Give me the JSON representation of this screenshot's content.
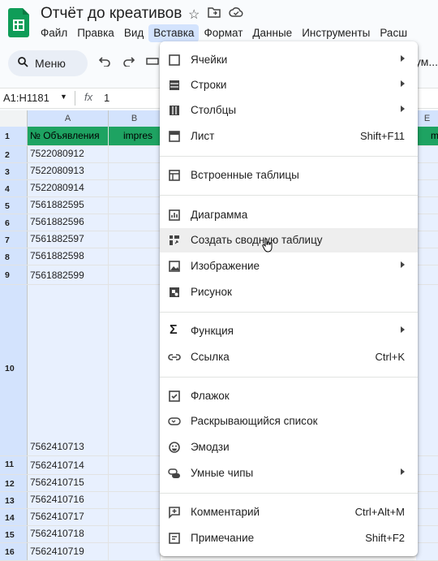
{
  "doc": {
    "title": "Отчёт до креативов"
  },
  "menubar": [
    "Файл",
    "Правка",
    "Вид",
    "Вставка",
    "Формат",
    "Данные",
    "Инструменты",
    "Расш"
  ],
  "toolbar": {
    "menu_label": "Меню",
    "right_text": "ум..."
  },
  "formula_bar": {
    "namebox": "A1:H1181",
    "fx": "fx",
    "value": "1"
  },
  "columns": [
    "A",
    "B",
    "E"
  ],
  "header_row": {
    "a": "№ Объявления",
    "b": "impres",
    "r": "m"
  },
  "rows": [
    {
      "num": "1"
    },
    {
      "num": "2",
      "a": "7522080912"
    },
    {
      "num": "3",
      "a": "7522080913"
    },
    {
      "num": "4",
      "a": "7522080914"
    },
    {
      "num": "5",
      "a": "7561882595"
    },
    {
      "num": "6",
      "a": "7561882596"
    },
    {
      "num": "7",
      "a": "7561882597"
    },
    {
      "num": "8",
      "a": "7561882598"
    },
    {
      "num": "9",
      "a": "7561882599"
    },
    {
      "num": "10",
      "a": "7562410713"
    },
    {
      "num": "11",
      "a": "7562410714"
    },
    {
      "num": "12",
      "a": "7562410715"
    },
    {
      "num": "13",
      "a": "7562410716"
    },
    {
      "num": "14",
      "a": "7562410717"
    },
    {
      "num": "15",
      "a": "7562410718"
    },
    {
      "num": "16",
      "a": "7562410719"
    }
  ],
  "insert_menu": {
    "items": [
      {
        "label": "Ячейки",
        "icon": "cells-icon"
      },
      {
        "label": "Строки",
        "icon": "rows-icon"
      },
      {
        "label": "Столбцы",
        "icon": "columns-icon"
      },
      {
        "label": "Лист",
        "icon": "sheet-icon",
        "shortcut": "Shift+F11"
      },
      {
        "label": "Встроенные таблицы",
        "icon": "table-icon"
      },
      {
        "label": "Диаграмма",
        "icon": "chart-icon"
      },
      {
        "label": "Создать сводную таблицу",
        "icon": "pivot-table-icon"
      },
      {
        "label": "Изображение",
        "icon": "image-icon"
      },
      {
        "label": "Рисунок",
        "icon": "drawing-icon"
      },
      {
        "label": "Функция",
        "icon": "sigma-icon"
      },
      {
        "label": "Ссылка",
        "icon": "link-icon",
        "shortcut": "Ctrl+K"
      },
      {
        "label": "Флажок",
        "icon": "checkbox-icon"
      },
      {
        "label": "Раскрывающийся список",
        "icon": "dropdown-icon"
      },
      {
        "label": "Эмодзи",
        "icon": "emoji-icon"
      },
      {
        "label": "Умные чипы",
        "icon": "smart-chips-icon"
      },
      {
        "label": "Комментарий",
        "icon": "comment-icon",
        "shortcut": "Ctrl+Alt+M"
      },
      {
        "label": "Примечание",
        "icon": "note-icon",
        "shortcut": "Shift+F2"
      }
    ]
  },
  "colors": {
    "header_green": "#1ea362",
    "selection_blue": "#d3e3fd",
    "sheets_green": "#0f9d58"
  }
}
